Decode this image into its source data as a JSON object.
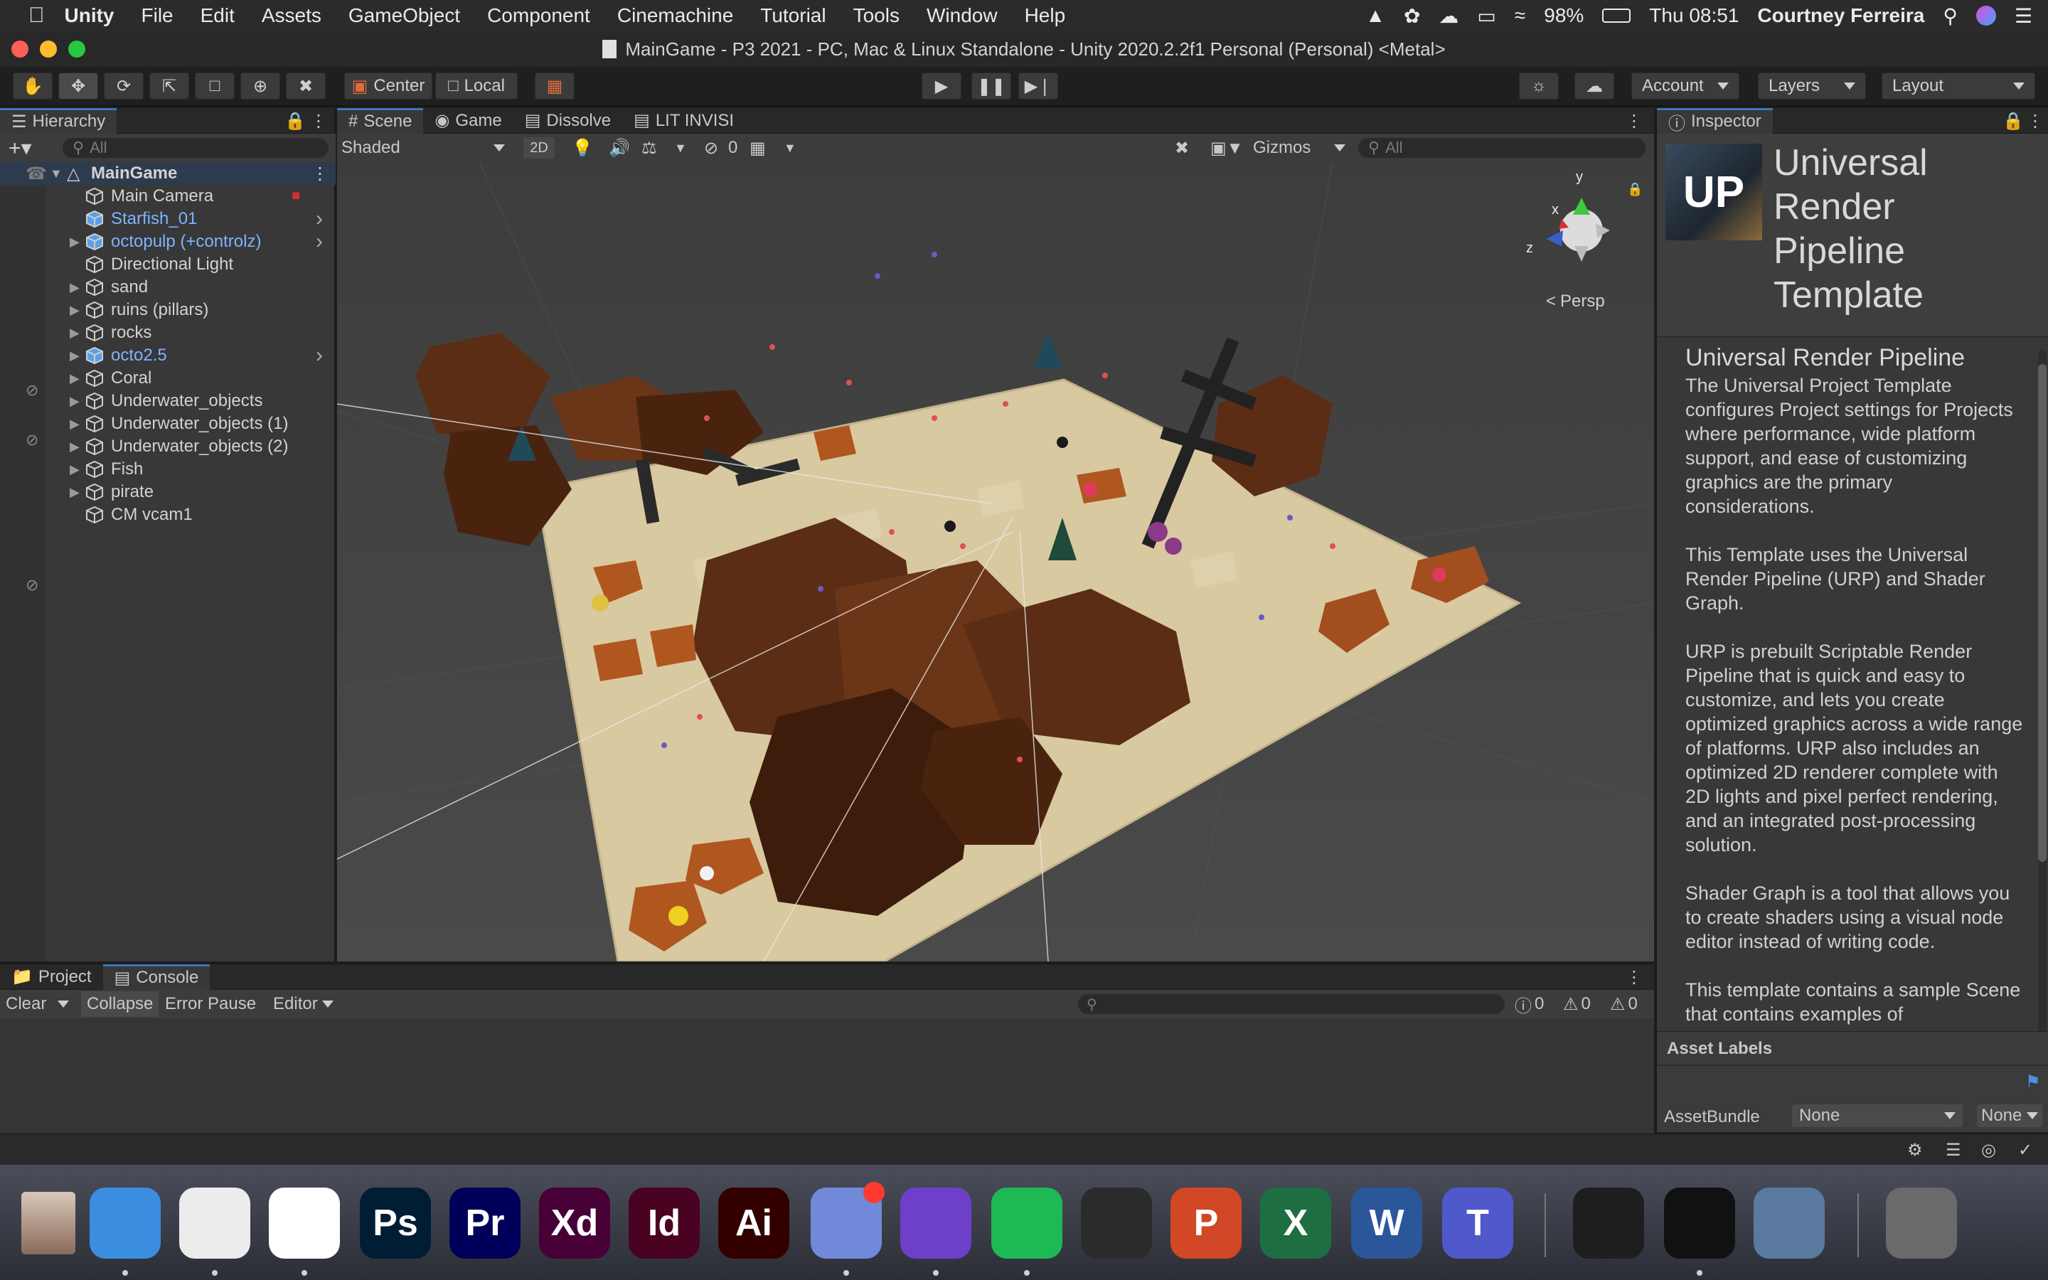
{
  "menubar": {
    "app": "Unity",
    "items": [
      "File",
      "Edit",
      "Assets",
      "GameObject",
      "Component",
      "Cinemachine",
      "Tutorial",
      "Tools",
      "Window",
      "Help"
    ],
    "battery": "98%",
    "clock": "Thu 08:51",
    "user": "Courtney Ferreira"
  },
  "window": {
    "title": "MainGame - P3 2021 - PC, Mac & Linux Standalone - Unity 2020.2.2f1 Personal (Personal) <Metal>"
  },
  "toolbar": {
    "pivot": "Center",
    "space": "Local",
    "account": "Account",
    "layers": "Layers",
    "layout": "Layout"
  },
  "hierarchy": {
    "title": "Hierarchy",
    "search_placeholder": "All",
    "scene": "MainGame",
    "items": [
      {
        "label": "Main Camera",
        "expand": false,
        "blue": false
      },
      {
        "label": "Starfish_01",
        "expand": false,
        "blue": true
      },
      {
        "label": "octopulp (+controlz)",
        "expand": true,
        "blue": true
      },
      {
        "label": "Directional Light",
        "expand": false,
        "blue": false
      },
      {
        "label": "sand",
        "expand": true,
        "blue": false
      },
      {
        "label": "ruins (pillars)",
        "expand": true,
        "blue": false
      },
      {
        "label": "rocks",
        "expand": true,
        "blue": false
      },
      {
        "label": "octo2.5",
        "expand": true,
        "blue": true
      },
      {
        "label": "Coral",
        "expand": true,
        "blue": false
      },
      {
        "label": "Underwater_objects",
        "expand": true,
        "blue": false
      },
      {
        "label": "Underwater_objects (1)",
        "expand": true,
        "blue": false
      },
      {
        "label": "Underwater_objects (2)",
        "expand": true,
        "blue": false
      },
      {
        "label": "Fish",
        "expand": true,
        "blue": false
      },
      {
        "label": "pirate",
        "expand": true,
        "blue": false
      },
      {
        "label": "CM vcam1",
        "expand": false,
        "blue": false
      }
    ]
  },
  "scene_tabs": [
    "Scene",
    "Game",
    "Dissolve",
    "LIT INVISI"
  ],
  "scene_toolbar": {
    "shading": "Shaded",
    "mode2d": "2D",
    "hidden_count": "0",
    "gizmos": "Gizmos",
    "search_placeholder": "All",
    "persp": "Persp",
    "axis_x": "x",
    "axis_y": "y",
    "axis_z": "z"
  },
  "inspector": {
    "tab": "Inspector",
    "logo": "UP",
    "title": "Universal Render Pipeline Template",
    "heading": "Universal Render Pipeline",
    "paragraphs": [
      "The Universal Project Template configures Project settings for Projects where performance, wide platform support, and ease of customizing graphics are the primary considerations.",
      "This Template uses the Universal Render Pipeline (URP) and Shader Graph.",
      "URP is prebuilt Scriptable Render Pipeline that is quick and easy to customize, and lets you create optimized graphics across a wide range of platforms. URP also includes an optimized 2D renderer complete with 2D lights and pixel perfect rendering, and an integrated post-processing solution.",
      "Shader Graph is a tool that allows you to create shaders using a visual node editor instead of writing code.",
      "This template contains a sample Scene that contains examples of"
    ],
    "asset_labels": "Asset Labels",
    "asset_bundle_label": "AssetBundle",
    "asset_bundle_value": "None",
    "asset_bundle_variant": "None"
  },
  "console": {
    "tabs": [
      "Project",
      "Console"
    ],
    "clear": "Clear",
    "collapse": "Collapse",
    "error_pause": "Error Pause",
    "editor": "Editor",
    "info_count": "0",
    "warn_count": "0",
    "error_count": "0"
  },
  "dock": {
    "apps": [
      {
        "name": "Finder",
        "text": "",
        "color": "#3b8de0"
      },
      {
        "name": "Unity Hub",
        "text": "",
        "color": "#ececec"
      },
      {
        "name": "Chrome",
        "text": "",
        "color": "#ffffff"
      },
      {
        "name": "Photoshop",
        "text": "Ps",
        "color": "#001d34"
      },
      {
        "name": "Premiere",
        "text": "Pr",
        "color": "#00005b"
      },
      {
        "name": "XD",
        "text": "Xd",
        "color": "#470137"
      },
      {
        "name": "InDesign",
        "text": "Id",
        "color": "#49021f"
      },
      {
        "name": "Illustrator",
        "text": "Ai",
        "color": "#330000"
      },
      {
        "name": "Discord",
        "text": "",
        "color": "#7289da"
      },
      {
        "name": "GitHub Desktop",
        "text": "",
        "color": "#6e40c9"
      },
      {
        "name": "Spotify",
        "text": "",
        "color": "#1db954"
      },
      {
        "name": "Blender",
        "text": "",
        "color": "#2b2b2b"
      },
      {
        "name": "PowerPoint",
        "text": "P",
        "color": "#d24726"
      },
      {
        "name": "Excel",
        "text": "X",
        "color": "#1d6f42"
      },
      {
        "name": "Word",
        "text": "W",
        "color": "#2b579a"
      },
      {
        "name": "Teams",
        "text": "T",
        "color": "#5059c9"
      },
      {
        "name": "VS Code",
        "text": "",
        "color": "#1e1e1e"
      },
      {
        "name": "Unity",
        "text": "",
        "color": "#111111"
      },
      {
        "name": "Preview",
        "text": "",
        "color": "#5a7aa0"
      },
      {
        "name": "Trash",
        "text": "",
        "color": "#6a6a6a"
      }
    ]
  }
}
